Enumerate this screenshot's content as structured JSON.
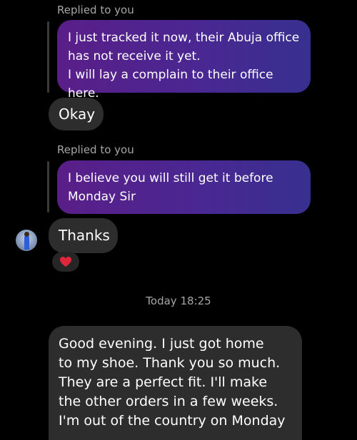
{
  "conversation": {
    "messages": [
      {
        "replied_label": "Replied to you",
        "lines": [
          "I just tracked it now, their Abuja office",
          "has not receive it yet.",
          "I will lay a complain to their office here."
        ]
      },
      {
        "reply_text": "Okay"
      },
      {
        "replied_label": "Replied to you",
        "lines": [
          "I believe you will still get it before",
          "Monday Sir"
        ]
      },
      {
        "reply_text": "Thanks",
        "reaction": "heart-emoji"
      }
    ],
    "timestamp": "Today 18:25",
    "last_message_lines": [
      "Good evening. I just got home",
      "to my shoe. Thank you so much.",
      "They are a perfect fit. I'll make",
      "the other orders in a few weeks.",
      "I'm out of the country on Monday"
    ]
  },
  "colors": {
    "background": "#000000",
    "incoming_bubble": "#2d2d2d",
    "quoted_gradient_start": "#5a1e88",
    "quoted_gradient_end": "#37308f",
    "reaction_heart": "#e0263b"
  }
}
